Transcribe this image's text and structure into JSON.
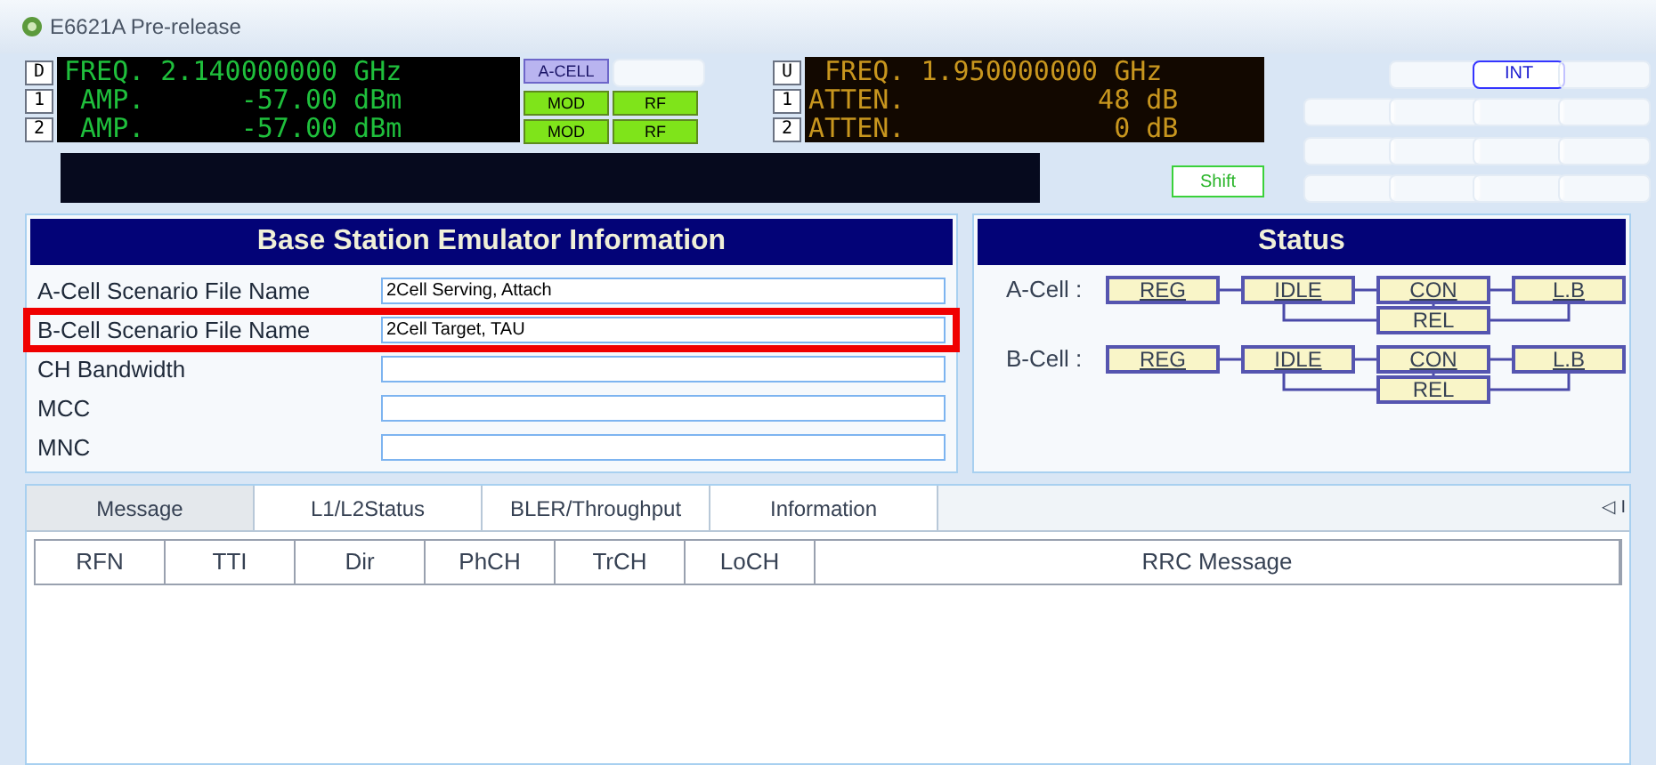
{
  "window": {
    "title": "E6621A Pre-release"
  },
  "downlink": {
    "lines": [
      {
        "key": "D",
        "text": "FREQ. 2.140000000 GHz"
      },
      {
        "key": "1",
        "text": " AMP.      -57.00 dBm"
      },
      {
        "key": "2",
        "text": " AMP.      -57.00 dBm"
      }
    ],
    "cell_buttons": [
      {
        "label": "A-CELL",
        "selected": true,
        "disabled": false
      }
    ],
    "line_buttons": [
      [
        {
          "label": "MOD",
          "on": true
        },
        {
          "label": "RF",
          "on": true
        }
      ],
      [
        {
          "label": "MOD",
          "on": true
        },
        {
          "label": "RF",
          "on": true
        }
      ]
    ]
  },
  "uplink": {
    "lines": [
      {
        "key": "U",
        "text": " FREQ. 1.950000000 GHz"
      },
      {
        "key": "1",
        "text": "ATTEN.            48 dB"
      },
      {
        "key": "2",
        "text": "ATTEN.             0 dB"
      }
    ]
  },
  "shift_button": {
    "label": "Shift"
  },
  "mode_buttons": [
    {
      "label": "INT",
      "selected": true
    }
  ],
  "info": {
    "title": "Base Station Emulator Information",
    "rows": [
      {
        "label": "A-Cell Scenario File Name",
        "value": "2Cell Serving, Attach",
        "highlighted": false
      },
      {
        "label": "B-Cell Scenario File Name",
        "value": "2Cell Target, TAU",
        "highlighted": true
      },
      {
        "label": "CH Bandwidth",
        "highlighted": false
      },
      {
        "label": "MCC",
        "highlighted": false
      },
      {
        "label": "MNC",
        "highlighted": false
      }
    ]
  },
  "status": {
    "title": "Status",
    "cells": [
      {
        "label": "A-Cell :",
        "states": [
          "REG",
          "IDLE",
          "CON",
          "L.B"
        ],
        "release": "REL"
      },
      {
        "label": "B-Cell :",
        "states": [
          "REG",
          "IDLE",
          "CON",
          "L.B"
        ],
        "release": "REL"
      }
    ]
  },
  "tabs": [
    {
      "label": "Message",
      "selected": true
    },
    {
      "label": "L1/L2Status",
      "selected": false
    },
    {
      "label": "BLER/Throughput",
      "selected": false
    },
    {
      "label": "Information",
      "selected": false
    }
  ],
  "tab_scroll": "◁ I",
  "table": {
    "columns": [
      "RFN",
      "TTI",
      "Dir",
      "PhCH",
      "TrCH",
      "LoCH",
      "RRC Message"
    ]
  }
}
